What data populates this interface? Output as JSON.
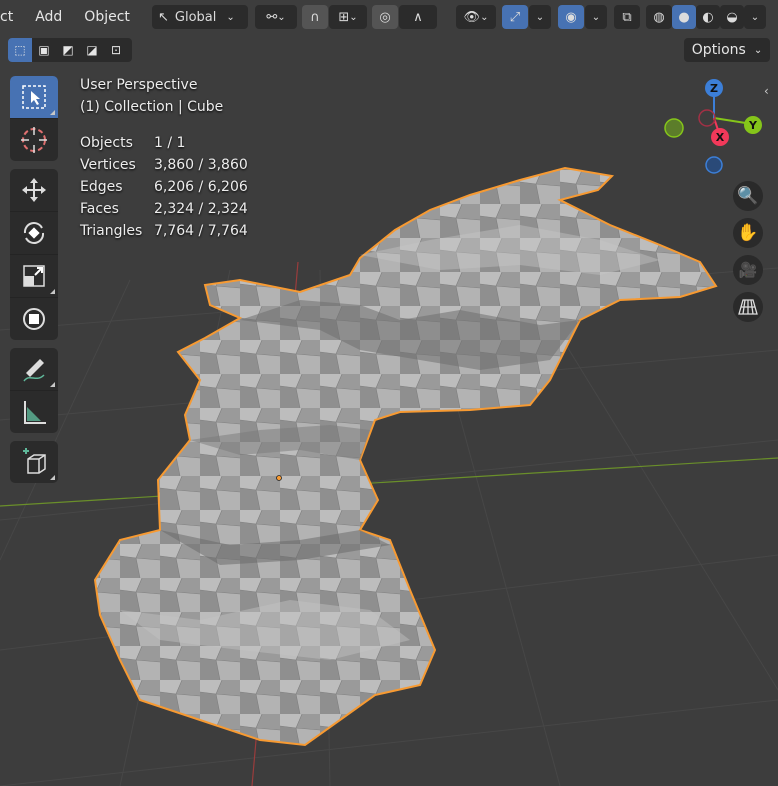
{
  "header": {
    "menus": [
      "ct",
      "Add",
      "Object"
    ],
    "transform_orientation": "Global",
    "icons": [
      "orientation-icon",
      "snap-link-icon",
      "snap-magnet-icon",
      "snap-increment-icon",
      "proportional-edit-icon",
      "falloff-icon",
      "visibility-icon",
      "gizmo-icon",
      "overlay-icon",
      "xray-icon",
      "wireframe-shading-icon",
      "solid-shading-icon",
      "material-shading-icon",
      "rendered-shading-icon"
    ]
  },
  "subheader": {
    "select_modes": [
      "select-new",
      "select-extend",
      "select-subtract",
      "select-invert",
      "select-intersect"
    ],
    "options_label": "Options"
  },
  "toolbar": {
    "tools": [
      "select-box",
      "cursor",
      "move",
      "rotate",
      "scale",
      "transform",
      "annotate",
      "measure",
      "add-cube"
    ]
  },
  "stats": {
    "perspective": "User Perspective",
    "collection": "(1) Collection | Cube",
    "rows": [
      {
        "label": "Objects",
        "value": "1 / 1"
      },
      {
        "label": "Vertices",
        "value": "3,860 / 3,860"
      },
      {
        "label": "Edges",
        "value": "6,206 / 6,206"
      },
      {
        "label": "Faces",
        "value": "2,324 / 2,324"
      },
      {
        "label": "Triangles",
        "value": "7,764 / 7,764"
      }
    ]
  },
  "gizmo": {
    "axes": [
      "Z",
      "Y",
      "X"
    ],
    "colors": {
      "x": "#f2395a",
      "y": "#85c51a",
      "z": "#3c7fd8"
    }
  },
  "colors": {
    "accent": "#4772b3",
    "selection_outline": "#f79a32",
    "background": "#3d3d3d"
  }
}
